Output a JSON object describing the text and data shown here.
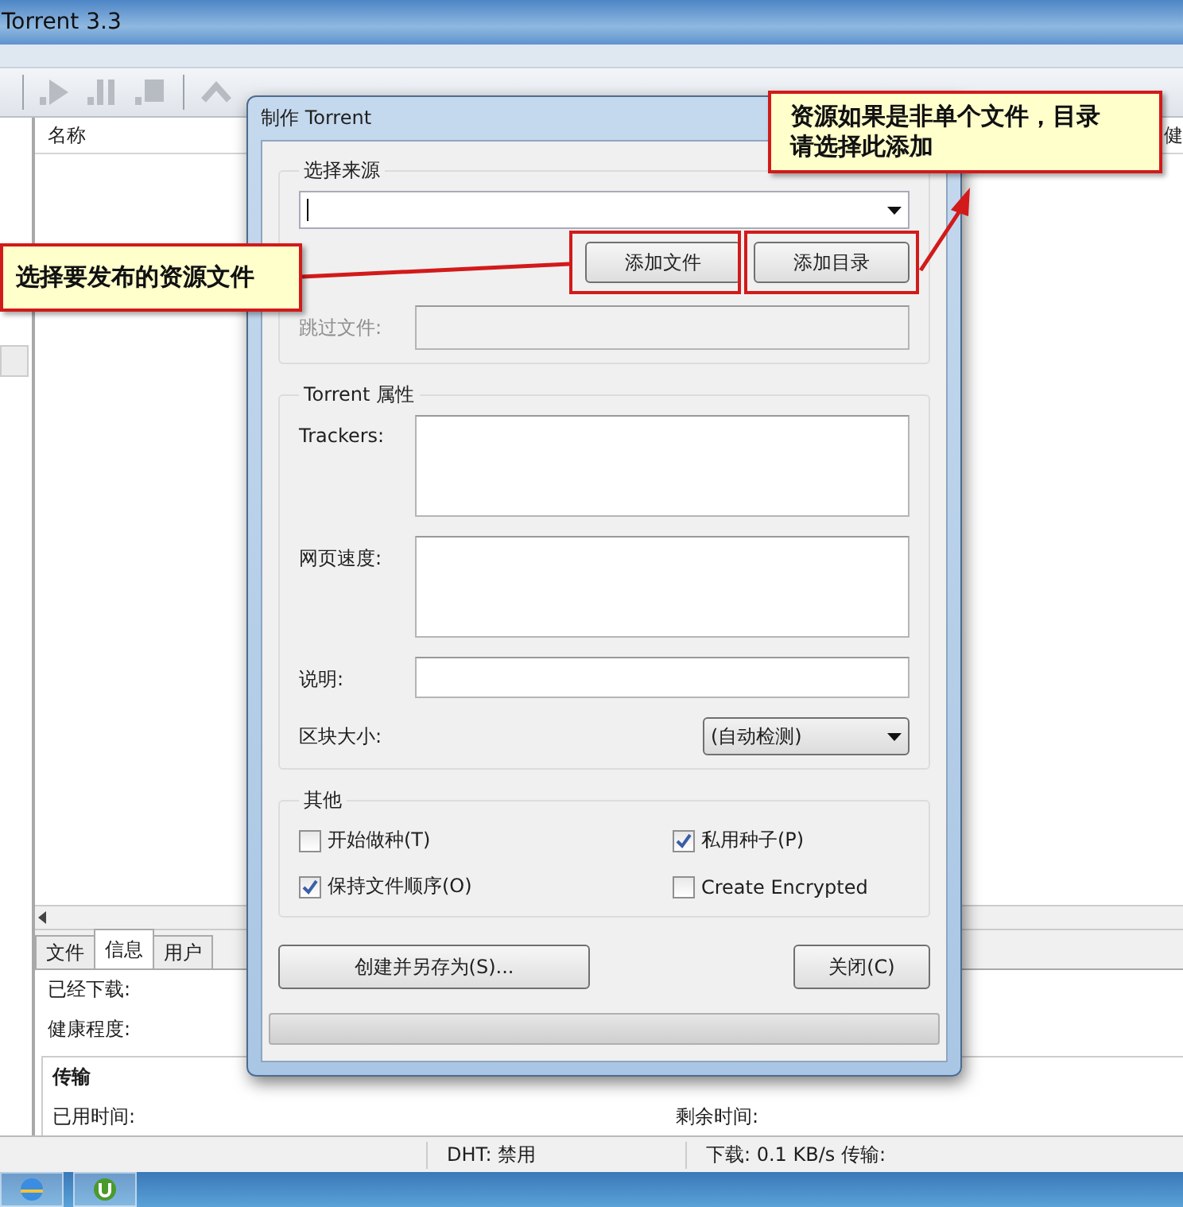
{
  "window": {
    "title": "Torrent 3.3"
  },
  "list": {
    "columns": [
      "名称",
      "健"
    ]
  },
  "detail_tabs": [
    {
      "label": "文件",
      "selected": false
    },
    {
      "label": "信息",
      "selected": true
    },
    {
      "label": "用户",
      "selected": false
    }
  ],
  "info": {
    "fields": [
      "已经下载:",
      "健康程度:"
    ],
    "section": "传输",
    "transfer_fields": [
      "已用时间:",
      "剩余时间:"
    ]
  },
  "status_bar": [
    "DHT: 禁用",
    "下载: 0.1 KB/s 传输:"
  ],
  "dialog": {
    "title": "制作 Torrent",
    "source": {
      "legend": "选择来源",
      "buttons": [
        "添加文件",
        "添加目录"
      ],
      "skip": {
        "label": "跳过文件:",
        "disabled": true
      }
    },
    "properties": {
      "legend": "Torrent 属性",
      "fields": [
        {
          "label": "Trackers:",
          "kind": "textarea"
        },
        {
          "label": "网页速度:",
          "kind": "textarea"
        },
        {
          "label": "说明:",
          "kind": "input"
        },
        {
          "label": "区块大小:",
          "kind": "select",
          "value": "(自动检测)"
        }
      ]
    },
    "other": {
      "legend": "其他",
      "options": [
        {
          "label": "开始做种(T)",
          "checked": false
        },
        {
          "label": "私用种子(P)",
          "checked": true
        },
        {
          "label": "保持文件顺序(O)",
          "checked": true
        },
        {
          "label": "Create Encrypted",
          "checked": false
        }
      ]
    },
    "buttons": [
      "创建并另存为(S)...",
      "关闭(C)"
    ],
    "progress": {
      "level": 0
    }
  },
  "callouts": [
    {
      "text": "选择要发布的资源文件"
    },
    {
      "text": "资源如果是非单个文件，目录请选择此添加"
    }
  ]
}
